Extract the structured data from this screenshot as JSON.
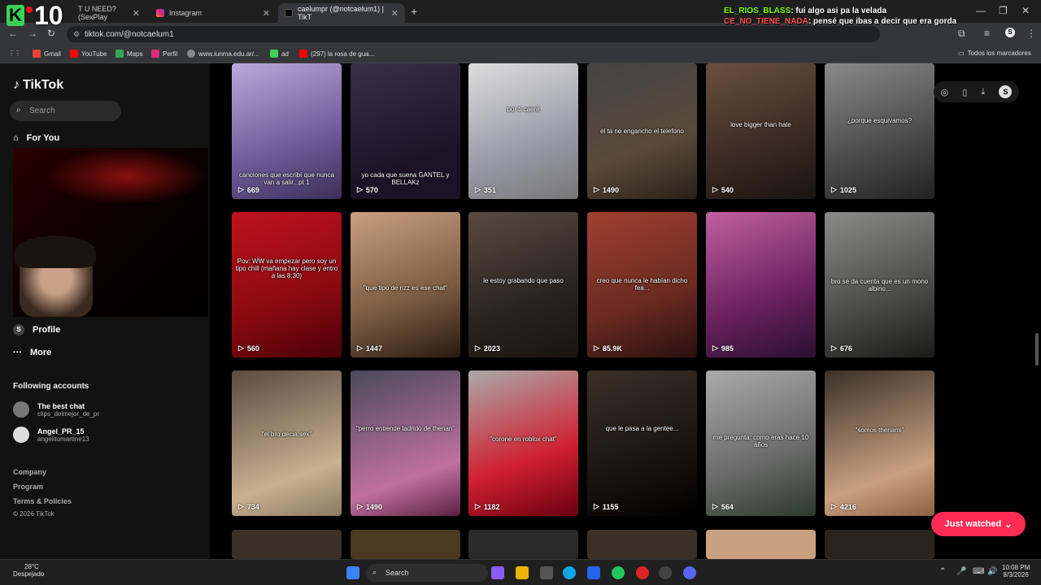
{
  "browser": {
    "tabs": [
      {
        "label": "T U NEED? (SexPlay"
      },
      {
        "label": "Instagram"
      },
      {
        "label": "caelumpr (@notcaelum1) | TikT"
      }
    ],
    "url": "tiktok.com/@notcaelum1",
    "bookmarks": [
      "Gmail",
      "YouTube",
      "Maps",
      "Perfil",
      "www.iunma.edu.ar/...",
      "ad",
      "(297) la rosa de gua..."
    ],
    "all_bookmarks": "Todos los marcadores"
  },
  "overlay": {
    "logo_letter": "K",
    "logo_num": "10",
    "chat": [
      {
        "user": "EL_RIOS_BLASS",
        "text": ": fui algo asi pa la velada"
      },
      {
        "user": "CE_NO_TIENE_NADA",
        "text": ": pensé que ibas a decir que era gorda"
      }
    ]
  },
  "sidebar": {
    "logo": "TikTok",
    "search_placeholder": "Search",
    "for_you": "For You",
    "profile": "Profile",
    "more": "More",
    "following_title": "Following accounts",
    "accounts": [
      {
        "name": "The best chat",
        "handle": "clips_delmejor_de_pr"
      },
      {
        "name": "Angel_PR_15",
        "handle": "angelitomartine13"
      }
    ],
    "footer": [
      "Company",
      "Program",
      "Terms & Policies",
      "© 2026 TikTok"
    ]
  },
  "videos": [
    {
      "views": "669",
      "caption": "canciones que escribí que nunca van a salir...pt 1"
    },
    {
      "views": "570",
      "caption": "yo cada que suena GANTEL y BELLAKz"
    },
    {
      "views": "351",
      "caption": "por ti caeré"
    },
    {
      "views": "1490",
      "caption": "el ta no engancho el telefono"
    },
    {
      "views": "540",
      "caption": "love bigger than hate"
    },
    {
      "views": "1025",
      "caption": "¿porque esquivamos?"
    },
    {
      "views": "560",
      "caption": "Pov: WW va empezar pero soy un tipo chill (mañana hay clase y entro a las 8:30)"
    },
    {
      "views": "1447",
      "caption": "\"que tipo de rizz es ese chat\""
    },
    {
      "views": "2023",
      "caption": "le estoy grabando que paso"
    },
    {
      "views": "85.9K",
      "caption": "creo que nunca le habían dicho fea..."
    },
    {
      "views": "985",
      "caption": ""
    },
    {
      "views": "676",
      "caption": "bro se da cuenta que es un mono albino..."
    },
    {
      "views": "734",
      "caption": "\"el bro decia sex\""
    },
    {
      "views": "1490",
      "caption": "\"perro entiende ladrido de therian\""
    },
    {
      "views": "1182",
      "caption": "\"corone en roblox chat\""
    },
    {
      "views": "1155",
      "caption": "que le pasa a la gentee..."
    },
    {
      "views": "564",
      "caption": "me pregunta: como eras hace 10 años"
    },
    {
      "views": "4216",
      "caption": "\"somos therians\""
    }
  ],
  "just_watched": "Just watched",
  "taskbar": {
    "temp": "28°C",
    "weather": "Despejado",
    "search": "Search",
    "time": "10:08 PM",
    "date": "8/3/2026"
  },
  "colors": {
    "accent": "#fe2c55",
    "chat_user1": "#7cfc00",
    "chat_user2": "#ff4d4d"
  }
}
